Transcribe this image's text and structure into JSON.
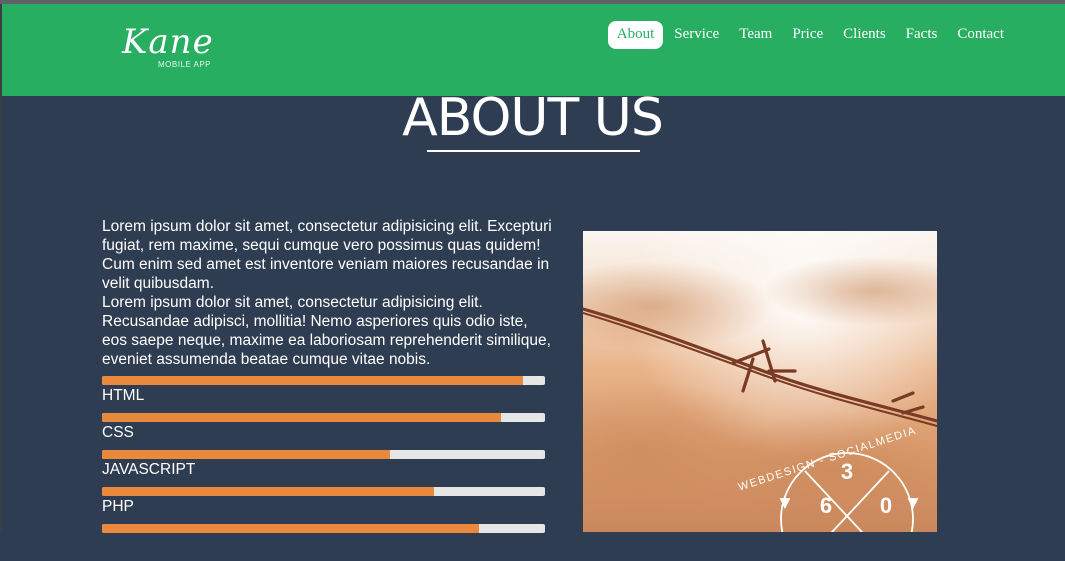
{
  "nav": {
    "logo_script": "Kane",
    "logo_sub": "MOBILE APP",
    "items": [
      "About",
      "Service",
      "Team",
      "Price",
      "Clients",
      "Facts",
      "Contact"
    ],
    "active_index": 0
  },
  "about": {
    "title": "ABOUT US",
    "paragraphs": [
      "Lorem ipsum dolor sit amet, consectetur adipisicing elit. Excepturi fugiat, rem maxime, sequi cumque vero possimus quas quidem! Cum enim sed amet est inventore veniam maiores recusandae in velit quibusdam.",
      "Lorem ipsum dolor sit amet, consectetur adipisicing elit. Recusandae adipisci, mollitia! Nemo asperiores quis odio iste, eos saepe neque, maxime ea laboriosam reprehenderit similique, eveniet assumenda beatae cumque vitae nobis."
    ],
    "skills": [
      {
        "label": "HTML",
        "percent": 95
      },
      {
        "label": "CSS",
        "percent": 90
      },
      {
        "label": "JAVASCRIPT",
        "percent": 65
      },
      {
        "label": "PHP",
        "percent": 75
      },
      {
        "label": "",
        "percent": 85
      }
    ]
  },
  "photo": {
    "badge_top": "3",
    "badge_left": "6",
    "badge_right": "0",
    "badge_ring_text": "WEBDESIGN - SOCIALMEDIA"
  },
  "colors": {
    "navbar": "#27ae60",
    "background": "#2e3d51",
    "progress_fill": "#e8893e",
    "progress_track": "#e6e6e6"
  }
}
